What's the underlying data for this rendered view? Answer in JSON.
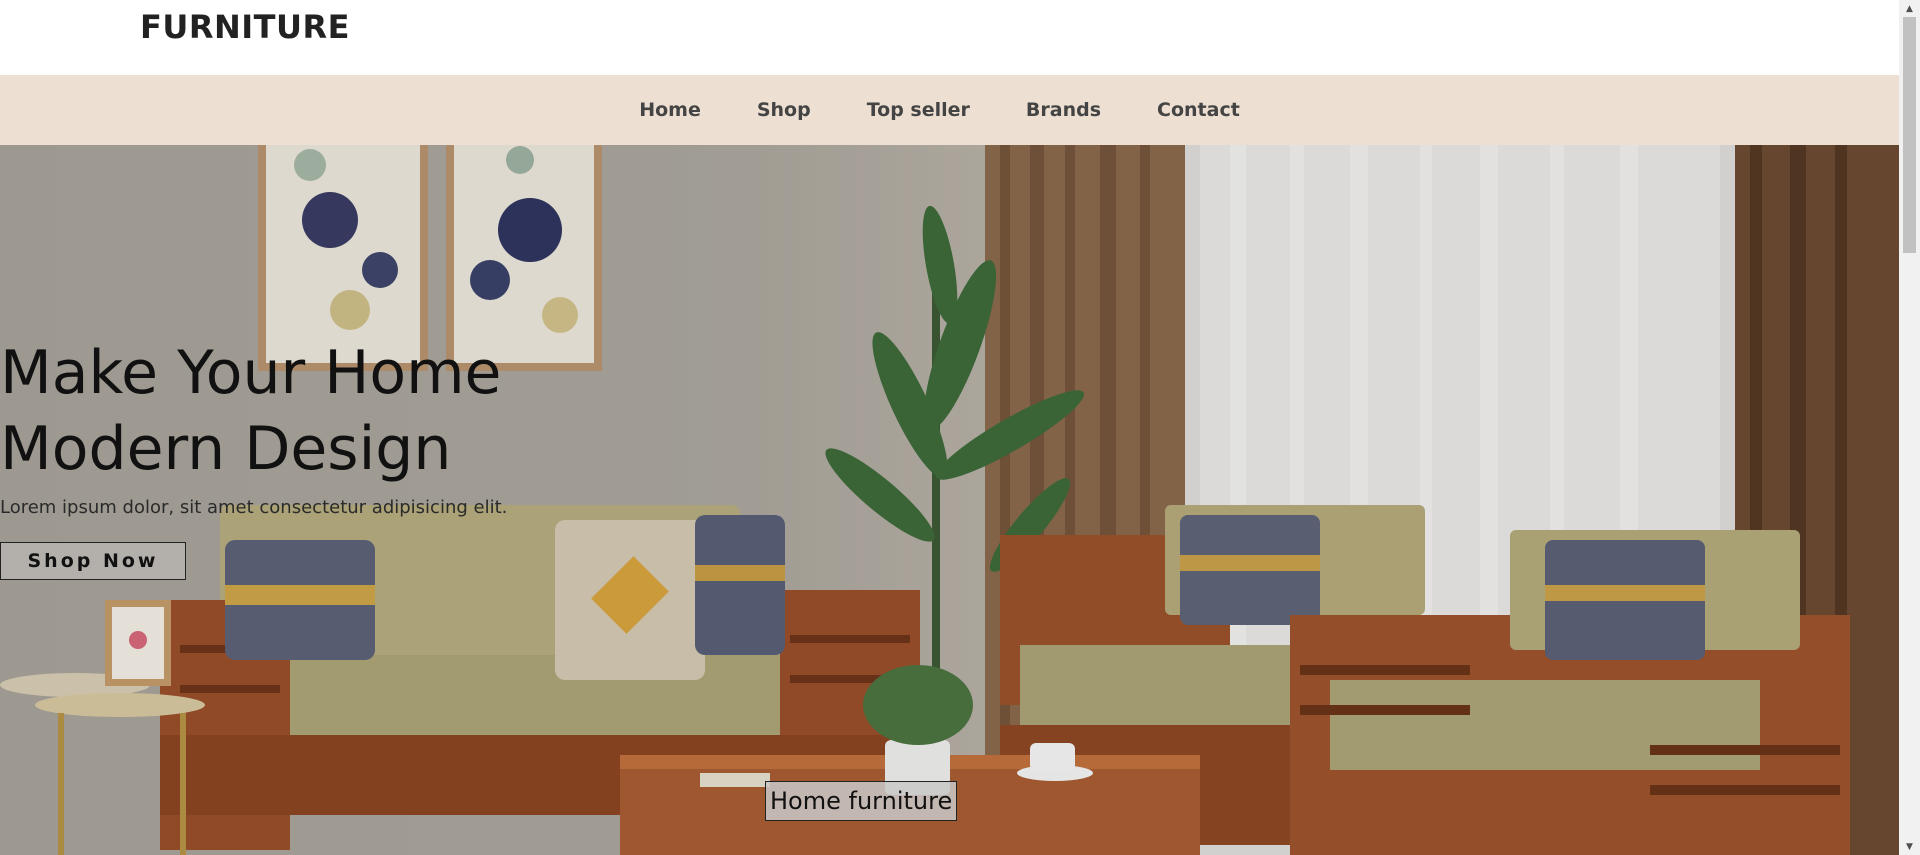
{
  "header": {
    "logo": "FURNITURE"
  },
  "nav": {
    "items": [
      {
        "label": "Home"
      },
      {
        "label": "Shop"
      },
      {
        "label": "Top seller"
      },
      {
        "label": "Brands"
      },
      {
        "label": "Contact"
      }
    ]
  },
  "hero": {
    "title": "Make Your Home Modern Design",
    "text": "Lorem ipsum dolor, sit amet consectetur adipisicing elit.",
    "button_label": "Shop Now",
    "image_caption": "Home furniture"
  },
  "colors": {
    "nav_background": "#ede0d2",
    "text_dark": "#111111",
    "button_background": "#b3b0ab"
  }
}
